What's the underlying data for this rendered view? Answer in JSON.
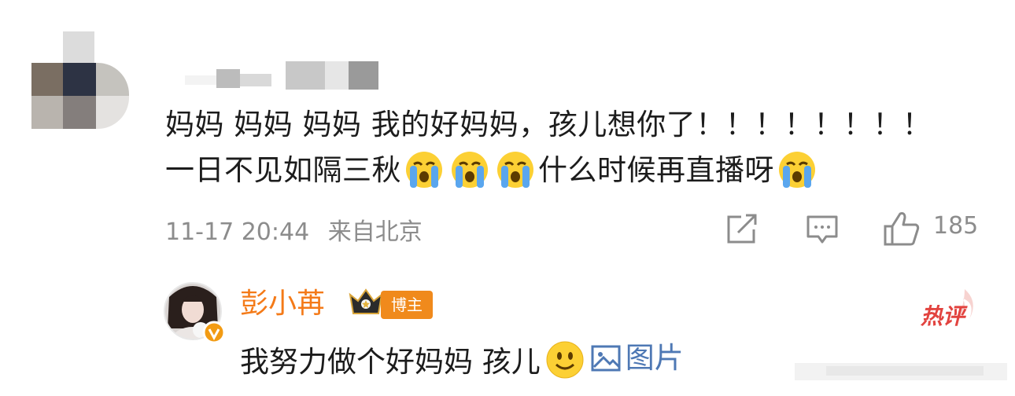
{
  "comment": {
    "author_avatar_label": "mosaic-avatar",
    "line1": "妈妈 妈妈 妈妈 我的好妈妈，孩儿想你了！！！！！！！！",
    "line2_part1": "一日不见如隔三秋",
    "line2_part2": "什么时候再直播呀",
    "date": "11-17 20:44",
    "location": "来自北京",
    "like_count": "185",
    "icons": [
      "crying-emoji",
      "crying-emoji",
      "crying-emoji",
      "crying-emoji",
      "share-icon",
      "comment-icon",
      "like-icon"
    ]
  },
  "reply": {
    "author_name": "彭小苒",
    "badge": "博主",
    "hot_tag": "热评",
    "text": "我努力做个好妈妈 孩儿",
    "image_link": "图片",
    "icons": [
      "crown-icon",
      "verified-icon",
      "smile-emoji",
      "image-icon"
    ]
  },
  "colors": {
    "name": "#f47a18",
    "badge": "#f08a1c",
    "hot": "#e2433f",
    "link": "#4e78b4",
    "meta": "#8c8c8c"
  }
}
